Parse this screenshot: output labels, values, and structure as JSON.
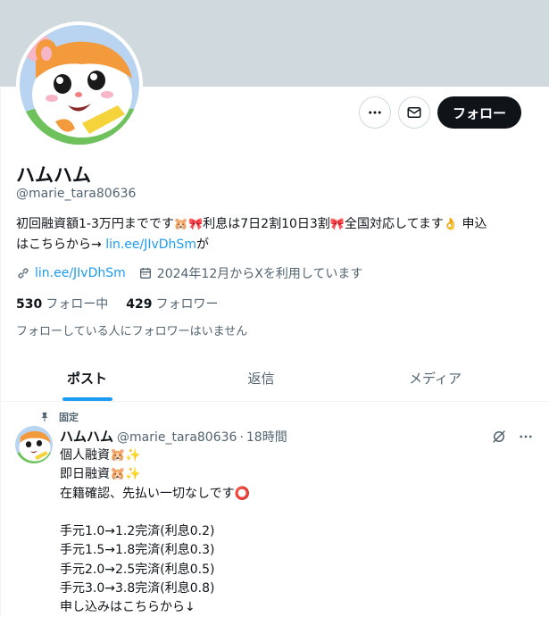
{
  "profile": {
    "display_name": "ハムハム",
    "handle": "@marie_tara80636",
    "bio_text_1": "初回融資額1-3万円までです",
    "bio_text_2": "利息は7日2割10日3割",
    "bio_text_3": "全国対応してます",
    "bio_text_4": " 申込",
    "bio_text_5": "はこちらから→ ",
    "bio_link": "lin.ee/JIvDhSm",
    "bio_text_6": "が",
    "website": "lin.ee/JIvDhSm",
    "joined": "2024年12月からXを利用しています",
    "following_count": "530",
    "following_label": "フォロー中",
    "followers_count": "429",
    "followers_label": "フォロワー",
    "no_mutual_followers": "フォローしている人にフォロワーはいません"
  },
  "actions": {
    "follow_label": "フォロー"
  },
  "tabs": [
    {
      "label": "ポスト",
      "active": true
    },
    {
      "label": "返信",
      "active": false
    },
    {
      "label": "メディア",
      "active": false
    }
  ],
  "pinned_tweet": {
    "pinned_label": "固定",
    "author_name": "ハムハム",
    "author_handle": "@marie_tara80636",
    "separator": "·",
    "time": "18時間",
    "lines": [
      "個人融資🐹✨",
      "即日融資🐹✨",
      "在籍確認、先払い一切なしです⭕",
      "",
      "手元1.0→1.2完済(利息0.2)",
      "手元1.5→1.8完済(利息0.3)",
      "手元2.0→2.5完済(利息0.5)",
      "手元3.0→3.8完済(利息0.8)",
      "申し込みはこちらから↓"
    ]
  },
  "colors": {
    "banner": "#cfd9de",
    "accent": "#1d9bf0",
    "text": "#0f1419",
    "muted": "#536471"
  }
}
